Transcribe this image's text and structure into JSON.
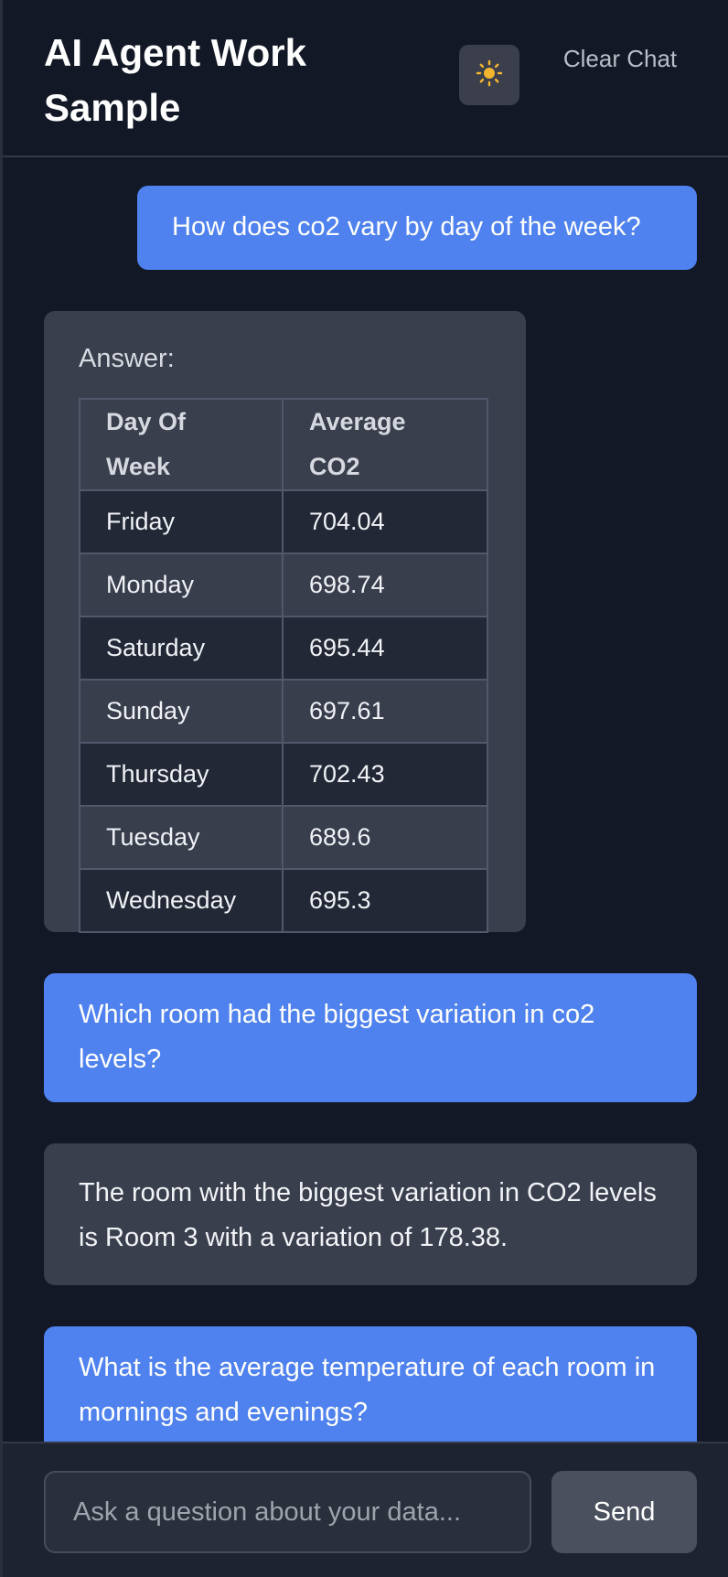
{
  "header": {
    "title": "AI Agent Work Sample",
    "theme_icon": "sun-icon",
    "clear_label": "Clear Chat"
  },
  "messages": {
    "q1": "How does co2 vary by day of the week?",
    "a1": {
      "label": "Answer:",
      "columns": [
        "Day Of Week",
        "Average CO2"
      ],
      "rows": [
        [
          "Friday",
          "704.04"
        ],
        [
          "Monday",
          "698.74"
        ],
        [
          "Saturday",
          "695.44"
        ],
        [
          "Sunday",
          "697.61"
        ],
        [
          "Thursday",
          "702.43"
        ],
        [
          "Tuesday",
          "689.6"
        ],
        [
          "Wednesday",
          "695.3"
        ]
      ]
    },
    "q2": "Which room had the biggest variation in co2 levels?",
    "a2": "The room with the biggest variation in CO2 levels is Room 3 with a variation of 178.38.",
    "q3": "What is the average temperature of each room in mornings and evenings?"
  },
  "footer": {
    "input_placeholder": "Ask a question about your data...",
    "send_label": "Send"
  },
  "colors": {
    "user_bubble": "#4f82ee",
    "bot_bubble": "#3a3f4d",
    "background": "#131826",
    "sun": "#f2b530"
  }
}
